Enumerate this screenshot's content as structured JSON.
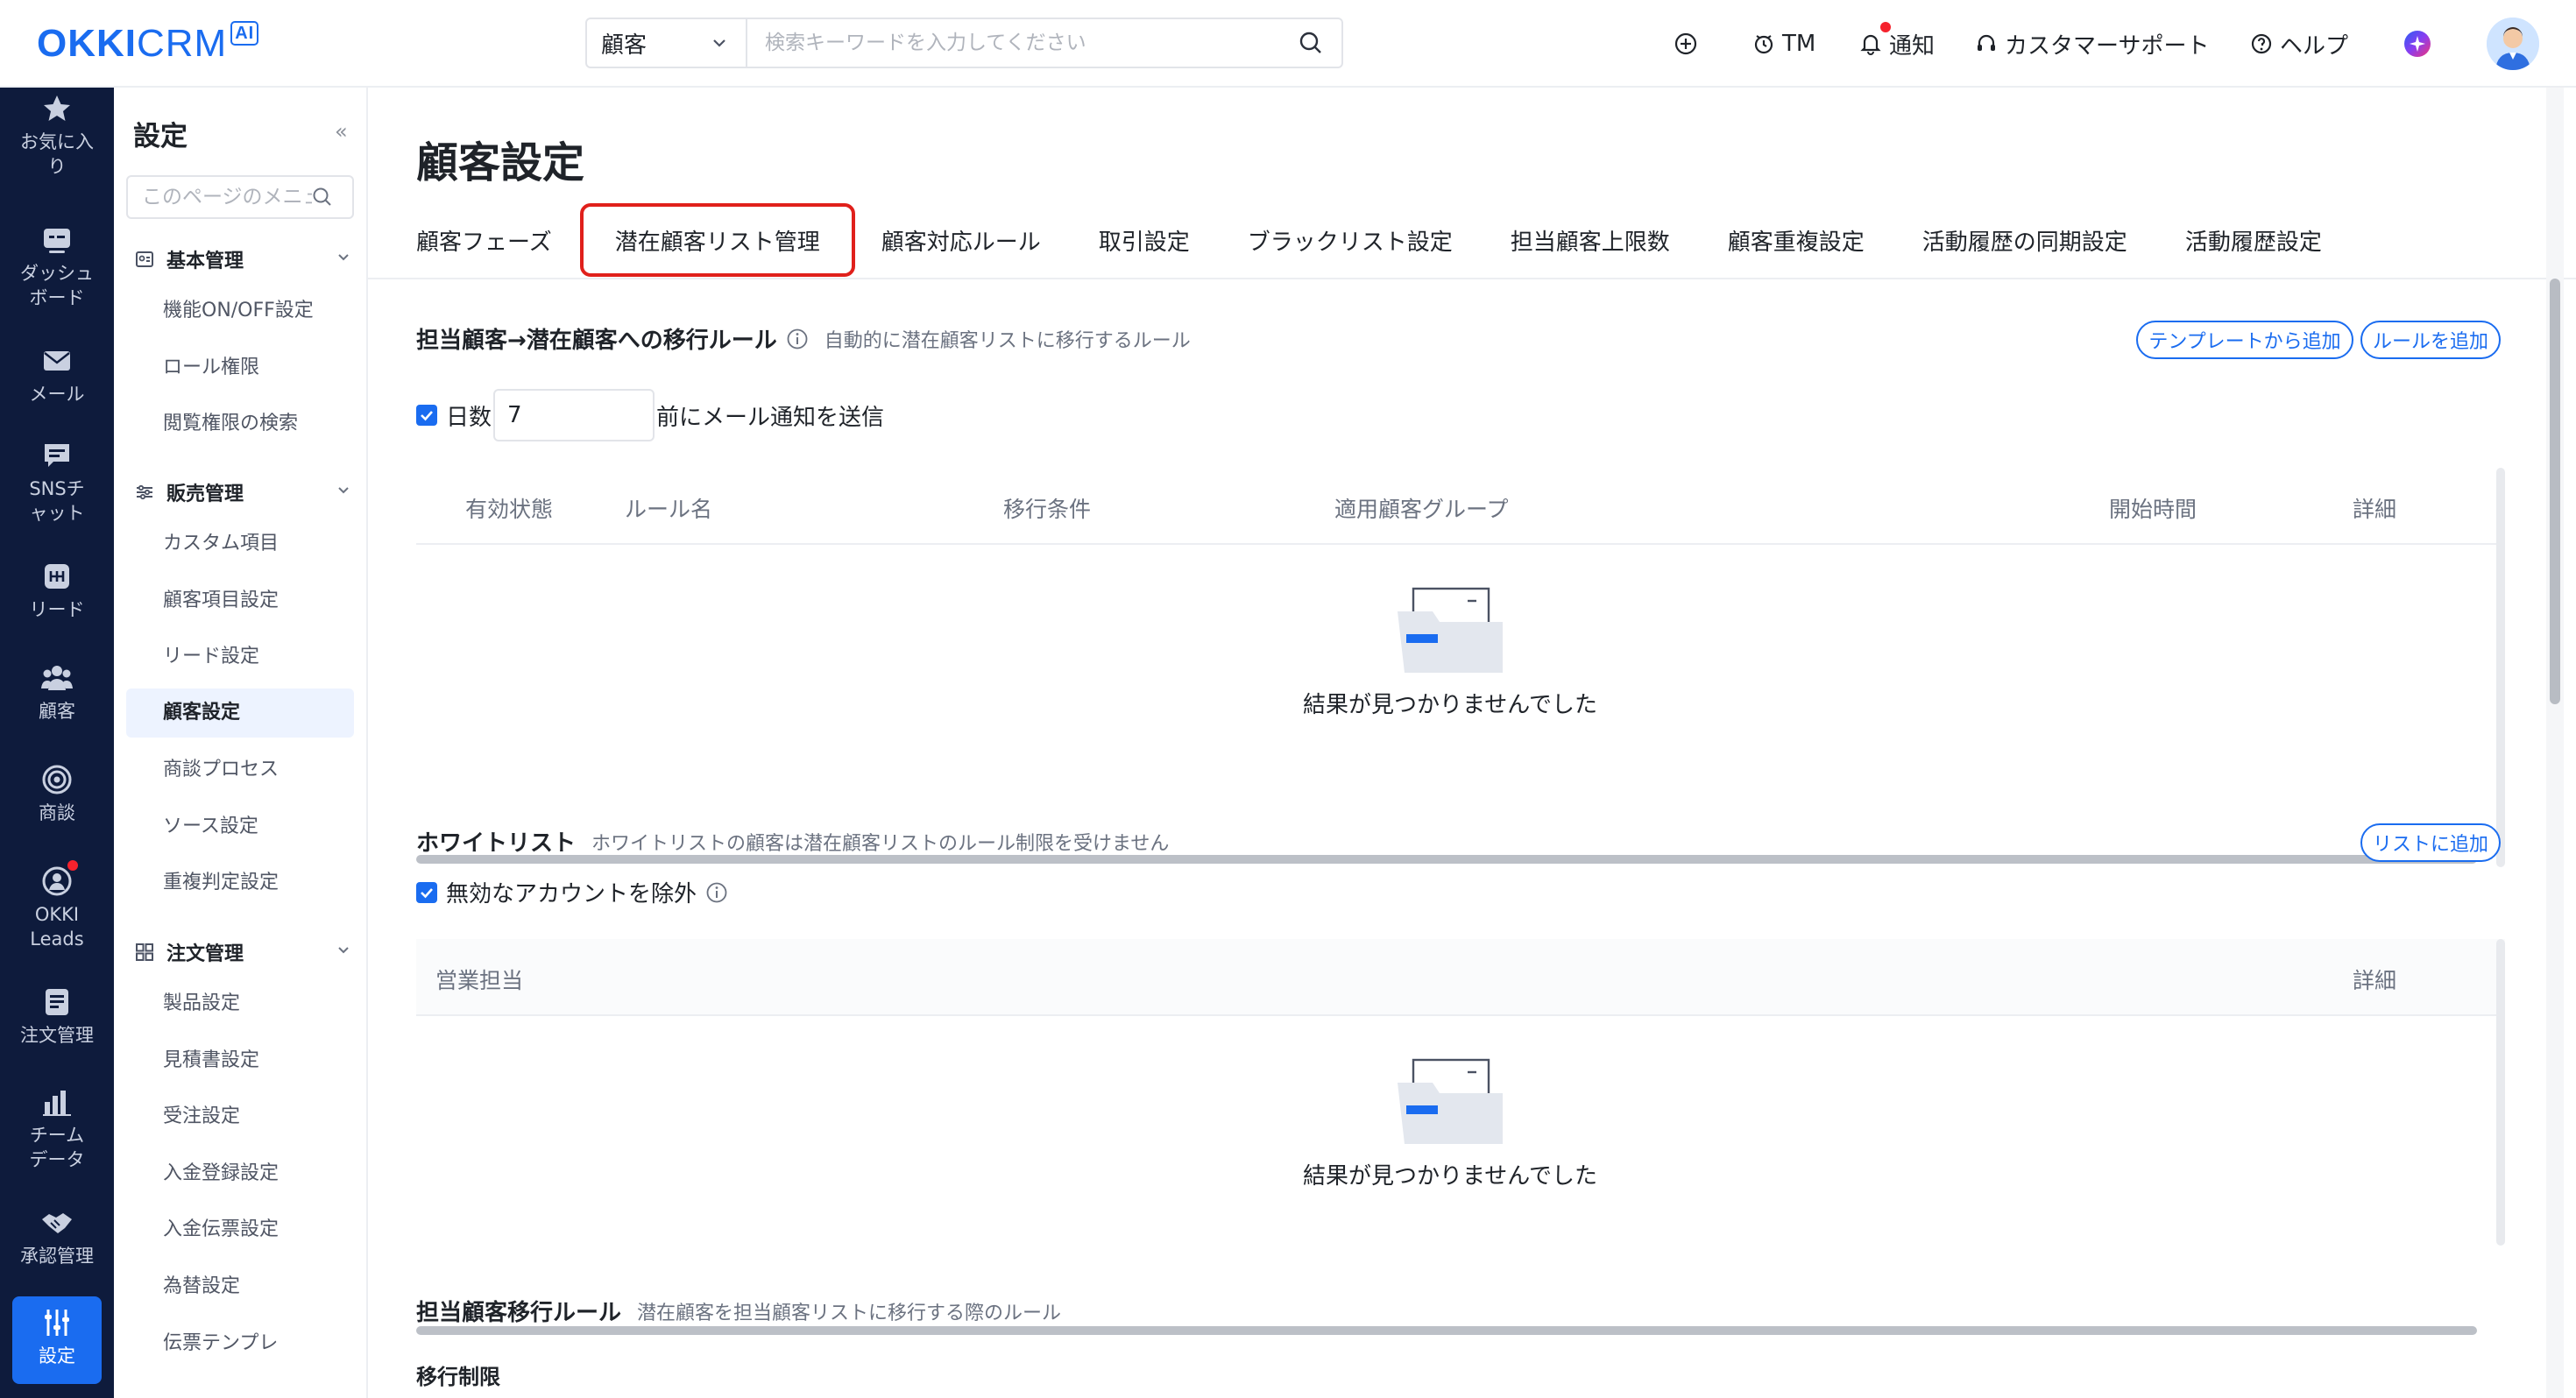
{
  "logo": {
    "okki": "OKKI",
    "crm": "CRM",
    "ai": "AI"
  },
  "search": {
    "type": "顧客",
    "placeholder": "検索キーワードを入力してください"
  },
  "topnav": {
    "tm": "TM",
    "notify": "通知",
    "support": "カスタマーサポート",
    "help": "ヘルプ"
  },
  "rail": [
    {
      "icon": "star-icon",
      "label": "お気に入り"
    },
    {
      "icon": "dashboard-icon",
      "label": "ダッシュボード"
    },
    {
      "icon": "mail-icon",
      "label": "メール"
    },
    {
      "icon": "chat-icon",
      "label": "SNSチャット"
    },
    {
      "icon": "leads-icon",
      "label": "リード"
    },
    {
      "icon": "customers-icon",
      "label": "顧客"
    },
    {
      "icon": "target-icon",
      "label": "商談"
    },
    {
      "icon": "okki-leads-icon",
      "label": "OKKI Leads"
    },
    {
      "icon": "order-icon",
      "label": "注文管理"
    },
    {
      "icon": "chart-icon",
      "label": "チームデータ"
    },
    {
      "icon": "handshake-icon",
      "label": "承認管理"
    },
    {
      "icon": "settings-icon",
      "label": "設定"
    }
  ],
  "sidebar": {
    "title": "設定",
    "collapse": "«",
    "search_placeholder": "このページのメニュー",
    "groups": [
      {
        "label": "基本管理",
        "items": [
          "機能ON/OFF設定",
          "ロール権限",
          "閲覧権限の検索"
        ]
      },
      {
        "label": "販売管理",
        "items": [
          "カスタム項目",
          "顧客項目設定",
          "リード設定",
          "顧客設定",
          "商談プロセス",
          "ソース設定",
          "重複判定設定"
        ]
      },
      {
        "label": "注文管理",
        "items": [
          "製品設定",
          "見積書設定",
          "受注設定",
          "入金登録設定",
          "入金伝票設定",
          "為替設定",
          "伝票テンプレ"
        ]
      }
    ],
    "active_item": "顧客設定"
  },
  "main": {
    "title": "顧客設定",
    "tabs": [
      "顧客フェーズ",
      "潜在顧客リスト管理",
      "顧客対応ルール",
      "取引設定",
      "ブラックリスト設定",
      "担当顧客上限数",
      "顧客重複設定",
      "活動履歴の同期設定",
      "活動履歴設定"
    ],
    "highlighted_tab": "潜在顧客リスト管理",
    "section1": {
      "title": "担当顧客→潜在顧客への移行ルール",
      "desc": "自動的に潜在顧客リストに移行するルール",
      "btn_template": "テンプレートから追加",
      "btn_rule": "ルールを追加",
      "notify_label_pre": "日数",
      "notify_days": "7",
      "notify_label_post": "前にメール通知を送信",
      "columns": [
        "有効状態",
        "ルール名",
        "移行条件",
        "適用顧客グループ",
        "開始時間",
        "詳細"
      ],
      "empty": "結果が見つかりませんでした"
    },
    "section2": {
      "title": "ホワイトリスト",
      "desc": "ホワイトリストの顧客は潜在顧客リストのルール制限を受けません",
      "btn_add": "リストに追加",
      "exclude_label": "無効なアカウントを除外",
      "columns": [
        "営業担当",
        "詳細"
      ],
      "empty": "結果が見つかりませんでした"
    },
    "section3": {
      "title": "担当顧客移行ルール",
      "desc": "潜在顧客を担当顧客リストに移行する際のルール",
      "sub": "移行制限"
    }
  },
  "colors": {
    "accent": "#1a6cf0",
    "rail_bg": "#0e1b3c",
    "highlight_border": "#e0201b",
    "badge": "#f5222d"
  }
}
